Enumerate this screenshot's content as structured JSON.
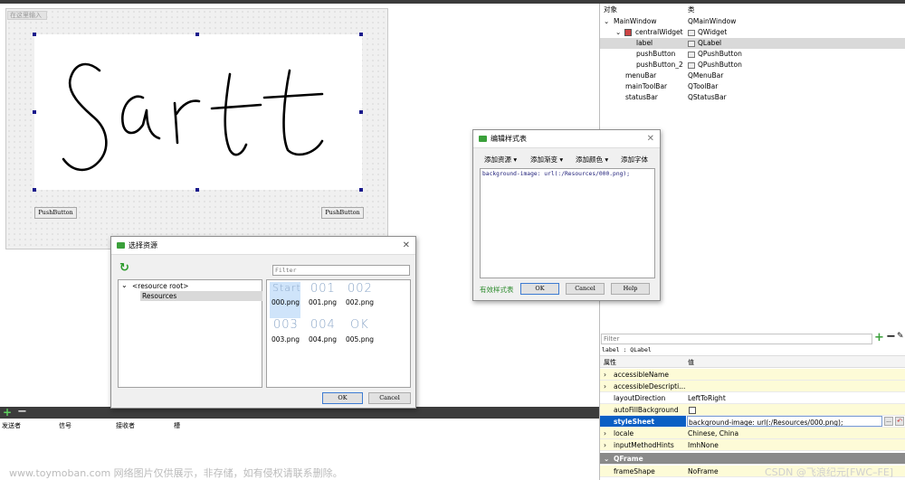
{
  "form": {
    "menu_placeholder": "在这里输入",
    "push_button_1": "PushButton",
    "push_button_2": "PushButton"
  },
  "object_inspector": {
    "col_object": "对象",
    "col_class": "类",
    "rows": [
      {
        "name": "MainWindow",
        "cls": "QMainWindow"
      },
      {
        "name": "centralWidget",
        "cls": "QWidget"
      },
      {
        "name": "label",
        "cls": "QLabel"
      },
      {
        "name": "pushButton",
        "cls": "QPushButton"
      },
      {
        "name": "pushButton_2",
        "cls": "QPushButton"
      },
      {
        "name": "menuBar",
        "cls": "QMenuBar"
      },
      {
        "name": "mainToolBar",
        "cls": "QToolBar"
      },
      {
        "name": "statusBar",
        "cls": "QStatusBar"
      }
    ]
  },
  "style_dialog": {
    "title": "编辑样式表",
    "add_resource": "添加资源",
    "add_gradient": "添加渐变",
    "add_color": "添加颜色",
    "add_font": "添加字体",
    "content": "background-image: url(:/Resources/000.png);",
    "valid_text": "有效样式表",
    "ok": "OK",
    "cancel": "Cancel",
    "help": "Help"
  },
  "resource_dialog": {
    "title": "选择资源",
    "filter_placeholder": "Filter",
    "root": "<resource root>",
    "folder": "Resources",
    "files": [
      {
        "preview": "Start",
        "name": "000.png"
      },
      {
        "preview": "001",
        "name": "001.png"
      },
      {
        "preview": "002",
        "name": "002.png"
      },
      {
        "preview": "003",
        "name": "003.png"
      },
      {
        "preview": "004",
        "name": "004.png"
      },
      {
        "preview": "OK",
        "name": "005.png"
      }
    ],
    "ok": "OK",
    "cancel": "Cancel"
  },
  "signal_table": {
    "headers": [
      "发送者",
      "信号",
      "接收者",
      "槽"
    ]
  },
  "property_editor": {
    "filter_placeholder": "Filter",
    "context": "label : QLabel",
    "col_property": "属性",
    "col_value": "值",
    "rows": [
      {
        "prop": "accessibleName",
        "val": ""
      },
      {
        "prop": "accessibleDescripti...",
        "val": ""
      },
      {
        "prop": "layoutDirection",
        "val": "LeftToRight"
      },
      {
        "prop": "autoFillBackground",
        "val": ""
      },
      {
        "prop": "styleSheet",
        "val": "background-image: url(:/Resources/000.png);"
      },
      {
        "prop": "locale",
        "val": "Chinese, China"
      },
      {
        "prop": "inputMethodHints",
        "val": "ImhNone"
      }
    ],
    "section": "QFrame",
    "frame_shape": "frameShape",
    "frame_shape_val": "NoFrame"
  },
  "watermark_left": "www.toymoban.com 网络图片仅供展示，非存储，如有侵权请联系删除。",
  "watermark_right": "CSDN @飞浪纪元[FWC–FE]",
  "colors": {
    "accent_green": "#3aa03a",
    "selection_blue": "#0a5fc4"
  }
}
